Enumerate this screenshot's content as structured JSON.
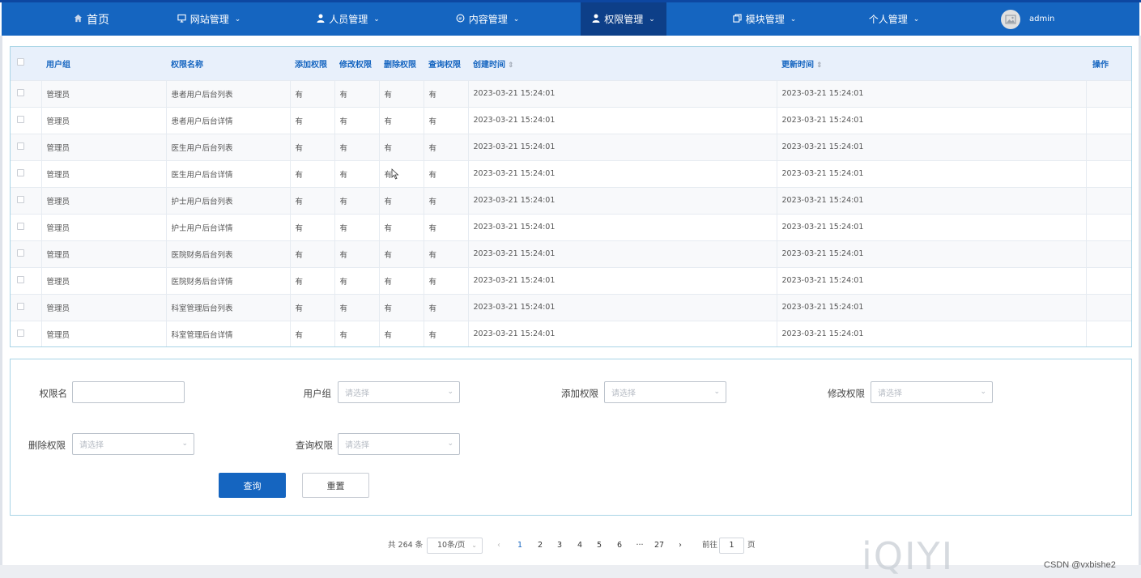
{
  "nav": {
    "home": "首页",
    "items": [
      {
        "label": "网站管理",
        "icon": "monitor-icon"
      },
      {
        "label": "人员管理",
        "icon": "person-icon"
      },
      {
        "label": "内容管理",
        "icon": "chat-icon"
      },
      {
        "label": "权限管理",
        "icon": "person-icon",
        "active": true
      },
      {
        "label": "模块管理",
        "icon": "copy-icon"
      },
      {
        "label": "个人管理",
        "icon": ""
      }
    ],
    "user": "admin"
  },
  "table": {
    "headers": {
      "group": "用户组",
      "name": "权限名称",
      "add": "添加权限",
      "edit": "修改权限",
      "del": "删除权限",
      "query": "查询权限",
      "created": "创建时间",
      "updated": "更新时间",
      "op": "操作"
    },
    "rows": [
      {
        "group": "管理员",
        "name": "患者用户后台列表",
        "add": "有",
        "edit": "有",
        "del": "有",
        "query": "有",
        "created": "2023-03-21 15:24:01",
        "updated": "2023-03-21 15:24:01"
      },
      {
        "group": "管理员",
        "name": "患者用户后台详情",
        "add": "有",
        "edit": "有",
        "del": "有",
        "query": "有",
        "created": "2023-03-21 15:24:01",
        "updated": "2023-03-21 15:24:01"
      },
      {
        "group": "管理员",
        "name": "医生用户后台列表",
        "add": "有",
        "edit": "有",
        "del": "有",
        "query": "有",
        "created": "2023-03-21 15:24:01",
        "updated": "2023-03-21 15:24:01"
      },
      {
        "group": "管理员",
        "name": "医生用户后台详情",
        "add": "有",
        "edit": "有",
        "del": "有",
        "query": "有",
        "created": "2023-03-21 15:24:01",
        "updated": "2023-03-21 15:24:01"
      },
      {
        "group": "管理员",
        "name": "护士用户后台列表",
        "add": "有",
        "edit": "有",
        "del": "有",
        "query": "有",
        "created": "2023-03-21 15:24:01",
        "updated": "2023-03-21 15:24:01"
      },
      {
        "group": "管理员",
        "name": "护士用户后台详情",
        "add": "有",
        "edit": "有",
        "del": "有",
        "query": "有",
        "created": "2023-03-21 15:24:01",
        "updated": "2023-03-21 15:24:01"
      },
      {
        "group": "管理员",
        "name": "医院财务后台列表",
        "add": "有",
        "edit": "有",
        "del": "有",
        "query": "有",
        "created": "2023-03-21 15:24:01",
        "updated": "2023-03-21 15:24:01"
      },
      {
        "group": "管理员",
        "name": "医院财务后台详情",
        "add": "有",
        "edit": "有",
        "del": "有",
        "query": "有",
        "created": "2023-03-21 15:24:01",
        "updated": "2023-03-21 15:24:01"
      },
      {
        "group": "管理员",
        "name": "科室管理后台列表",
        "add": "有",
        "edit": "有",
        "del": "有",
        "query": "有",
        "created": "2023-03-21 15:24:01",
        "updated": "2023-03-21 15:24:01"
      },
      {
        "group": "管理员",
        "name": "科室管理后台详情",
        "add": "有",
        "edit": "有",
        "del": "有",
        "query": "有",
        "created": "2023-03-21 15:24:01",
        "updated": "2023-03-21 15:24:01"
      }
    ]
  },
  "form": {
    "name_label": "权限名",
    "name_value": "",
    "group_label": "用户组",
    "add_label": "添加权限",
    "edit_label": "修改权限",
    "del_label": "删除权限",
    "query_label": "查询权限",
    "select_placeholder": "请选择",
    "search_button": "查询",
    "reset_button": "重置"
  },
  "pagination": {
    "total": "共 264 条",
    "page_size": "10条/页",
    "pages": [
      "1",
      "2",
      "3",
      "4",
      "5",
      "6",
      "···",
      "27"
    ],
    "current": "1",
    "goto_label": "前往",
    "goto_value": "1",
    "page_suffix": "页"
  },
  "watermarks": {
    "iqiyi": "iQIYI",
    "csdn": "CSDN @vxbishe2"
  },
  "colors": {
    "nav_bg": "#1565c0",
    "nav_active": "#0d3f88",
    "header_text": "#1565c0",
    "primary_button": "#1565c0"
  }
}
